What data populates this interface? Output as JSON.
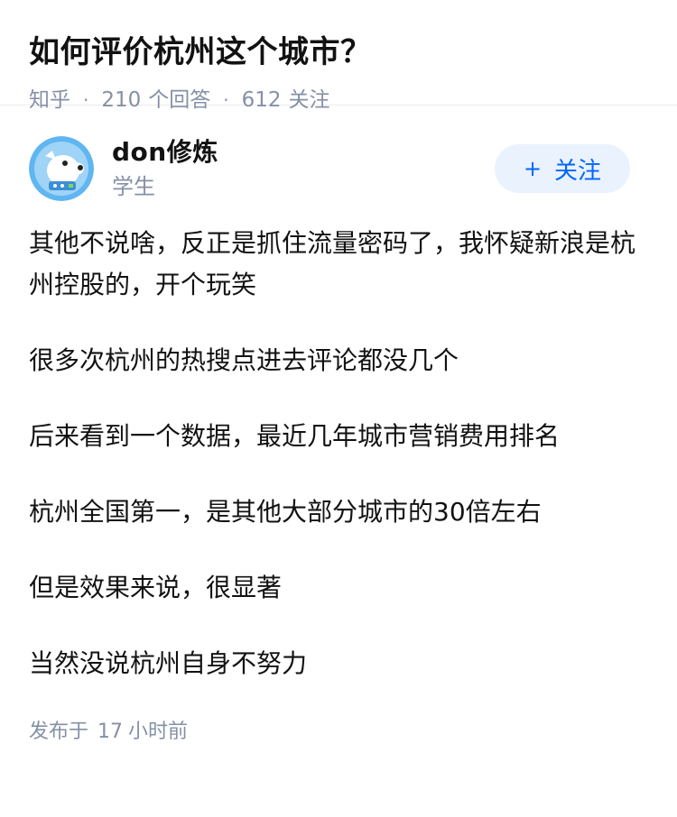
{
  "question": {
    "title": "如何评价杭州这个城市？",
    "source": "知乎",
    "answers_count": "210",
    "answers_label": "个回答",
    "followers_count": "612",
    "followers_label": "关注"
  },
  "author": {
    "name": "don修炼",
    "headline": "学生",
    "avatar_icon": "dog-avatar-icon",
    "follow_label": "关注",
    "follow_icon": "+"
  },
  "content": {
    "paragraphs": [
      "其他不说啥，反正是抓住流量密码了，我怀疑新浪是杭州控股的，开个玩笑",
      "很多次杭州的热搜点进去评论都没几个",
      "后来看到一个数据，最近几年城市营销费用排名",
      "杭州全国第一，是其他大部分城市的30倍左右",
      "但是效果来说，很显著",
      "当然没说杭州自身不努力"
    ]
  },
  "footer": {
    "published_label": "发布于",
    "published_num": "17",
    "published_unit": "小时前"
  },
  "colors": {
    "accent": "#0066ff",
    "meta": "#8590a6",
    "follow_bg": "#eaf2fd"
  }
}
